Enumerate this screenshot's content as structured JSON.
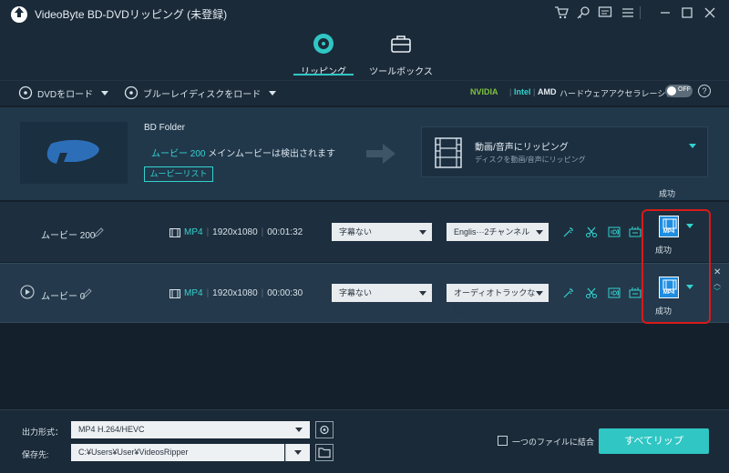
{
  "app": {
    "title": "VideoByte BD-DVDリッピング (未登録)"
  },
  "tabs": [
    {
      "label": "リッピング",
      "active": true
    },
    {
      "label": "ツールボックス",
      "active": false
    }
  ],
  "toolbar": {
    "load_dvd": "DVDをロード",
    "load_bluray": "ブルーレイディスクをロード",
    "hw": {
      "nvidia": "NVIDIA",
      "intel": "Intel",
      "amd": "AMD",
      "label": "ハードウェアアクセラレーション",
      "toggle": "OFF"
    }
  },
  "source": {
    "name": "BD Folder",
    "info_highlight": "ムービー 200",
    "info_rest": " メインムービーは検出されます",
    "movie_list_button": "ムービーリスト"
  },
  "output": {
    "title": "動画/音声にリッピング",
    "subtitle": "ディスクを動画/音声にリッピング",
    "status_top": "成功"
  },
  "rows": [
    {
      "title": "ムービー 200",
      "format": "MP4",
      "resolution": "1920x1080",
      "duration": "00:01:32",
      "subtitle": "字幕ない",
      "audio": "Englis···2チャンネル",
      "badge": "MP4",
      "status": "成功"
    },
    {
      "title": "ムービー 0",
      "format": "MP4",
      "resolution": "1920x1080",
      "duration": "00:00:30",
      "subtitle": "字幕ない",
      "audio": "オーディオトラックない",
      "badge": "MP4",
      "status": "成功"
    }
  ],
  "footer": {
    "output_format_label": "出力形式：",
    "output_format_value": "MP4 H.264/HEVC",
    "save_to_label": "保存先:",
    "save_to_value": "C:¥Users¥User¥VideosRipper",
    "merge_label": "一つのファイルに結合",
    "rip_all_button": "すべてリップ"
  },
  "colors": {
    "accent": "#2fc6c4",
    "highlight_box": "#d81a1a"
  }
}
